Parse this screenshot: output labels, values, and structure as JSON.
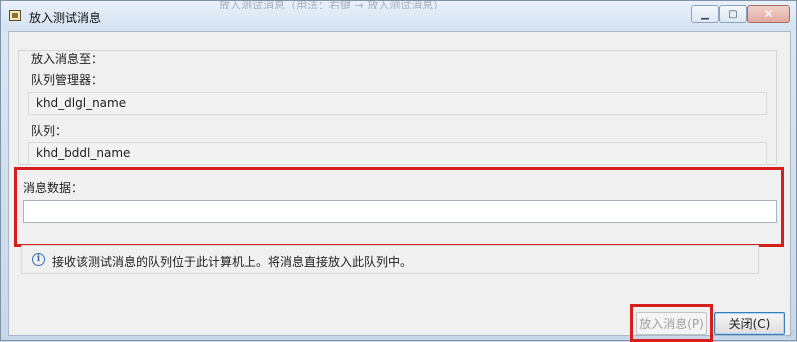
{
  "window": {
    "title": "放入测试消息",
    "ghost_title": "放入测试消息（用法：右键 → 放入测试消息）"
  },
  "group": {
    "legend": "放入消息至："
  },
  "queue_manager": {
    "label": "队列管理器：",
    "value": "khd_dlgl_name"
  },
  "queue": {
    "label": "队列：",
    "value": "khd_bddl_name"
  },
  "message": {
    "label": "消息数据：",
    "value": "",
    "placeholder": ""
  },
  "info": {
    "icon": "info-icon",
    "text": "接收该测试消息的队列位于此计算机上。将消息直接放入此队列中。"
  },
  "buttons": {
    "put": "放入消息(P)",
    "close": "关闭(C)"
  },
  "colors": {
    "highlight": "#d51f1f",
    "title_bar": "#dce7f3",
    "dialog_bg": "#f0f0f0"
  }
}
